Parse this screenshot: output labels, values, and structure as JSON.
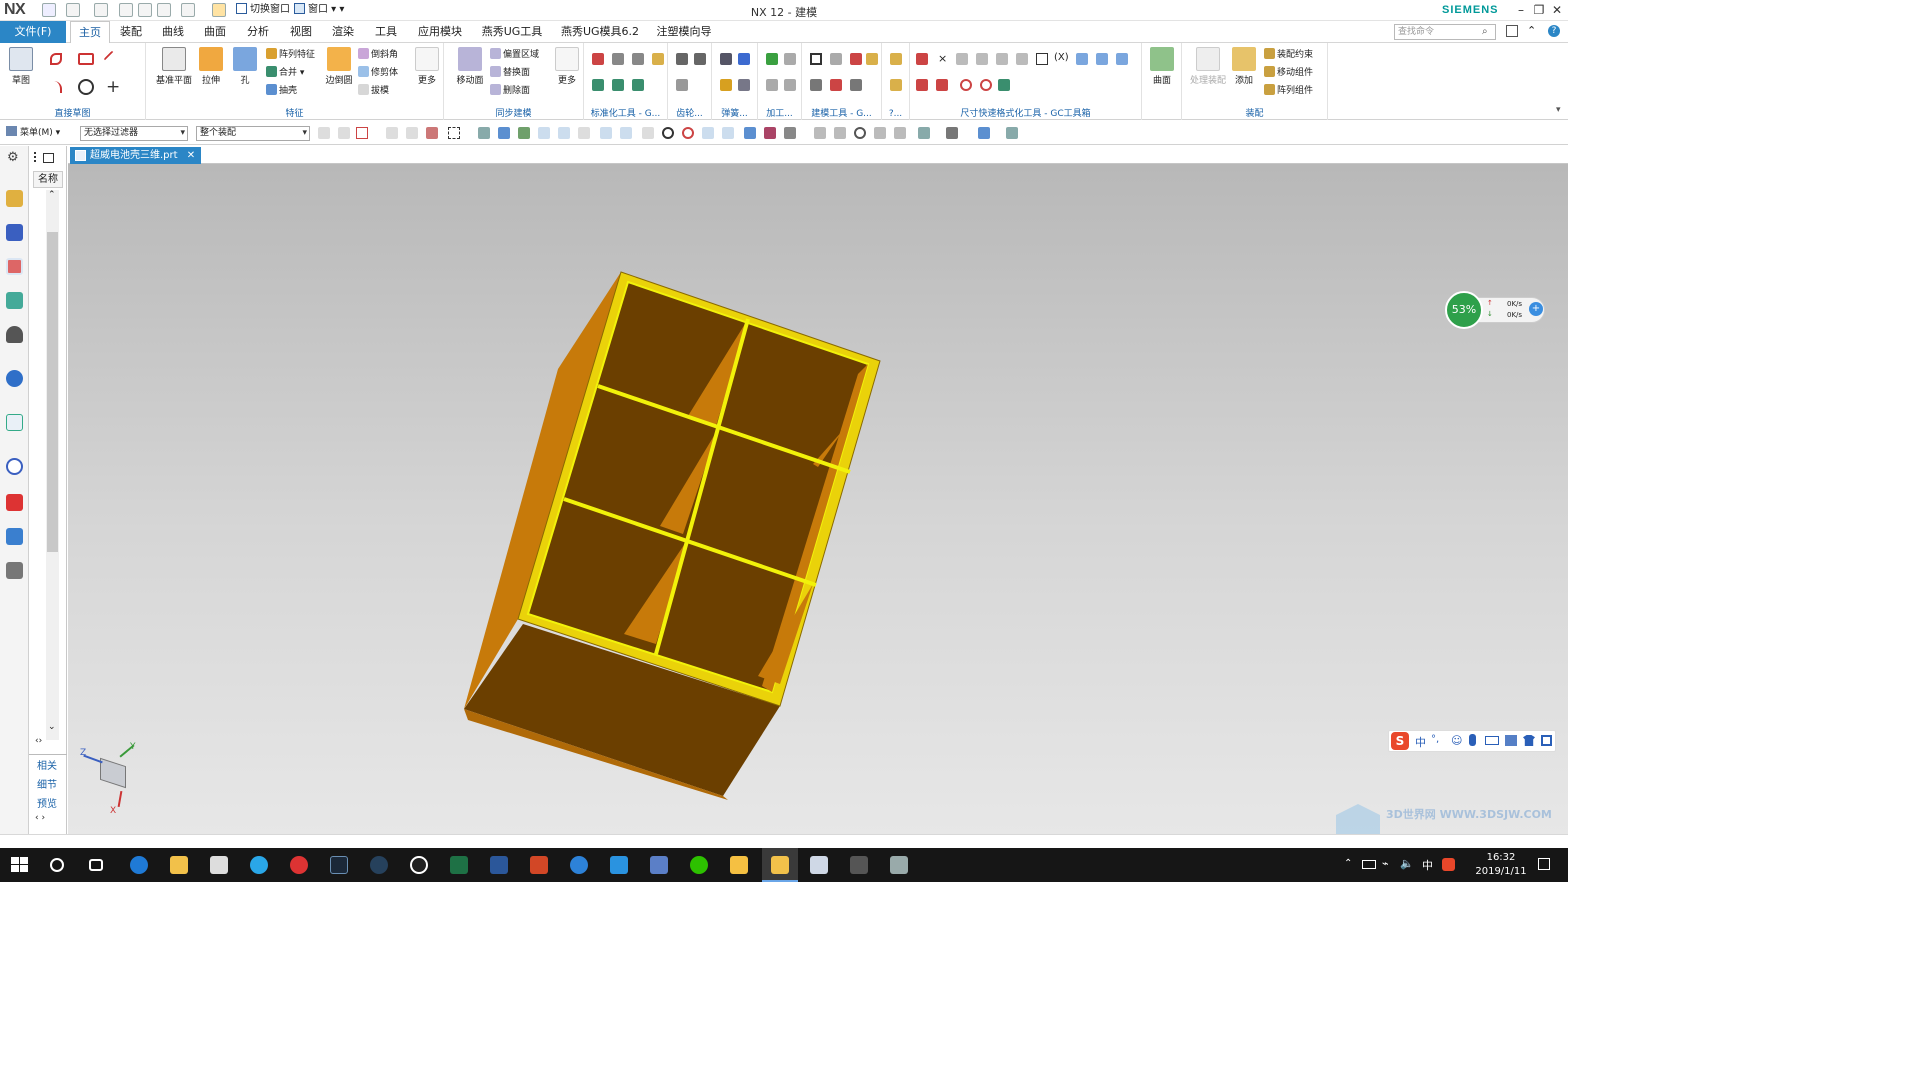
{
  "window": {
    "app_logo": "NX",
    "title": "NX 12 - 建模",
    "brand": "SIEMENS",
    "controls": [
      "minimize-icon",
      "restore-icon",
      "close-icon"
    ]
  },
  "quick_access": {
    "switch_window": "切换窗口",
    "window": "窗口"
  },
  "menubar": {
    "file": "文件(F)",
    "tabs": [
      "主页",
      "装配",
      "曲线",
      "曲面",
      "分析",
      "视图",
      "渲染",
      "工具",
      "应用模块",
      "燕秀UG工具",
      "燕秀UG模具6.2",
      "注塑模向导"
    ],
    "active_tab": "主页",
    "search_placeholder": "查找命令"
  },
  "ribbon": {
    "groups": [
      {
        "label": "直接草图",
        "buttons": [
          "草图"
        ]
      },
      {
        "label": "特征",
        "buttons": [
          "基准平面",
          "拉伸",
          "孔",
          "阵列特征",
          "合并",
          "抽壳",
          "边倒圆",
          "倒斜角",
          "修剪体",
          "拔模",
          "更多"
        ]
      },
      {
        "label": "同步建模",
        "buttons": [
          "移动面",
          "偏置区域",
          "替换面",
          "删除面",
          "更多"
        ]
      },
      {
        "label": "标准化工具 - G...",
        "buttons": []
      },
      {
        "label": "齿轮...",
        "buttons": []
      },
      {
        "label": "弹簧...",
        "buttons": []
      },
      {
        "label": "加工...",
        "buttons": []
      },
      {
        "label": "建模工具 - G...",
        "buttons": []
      },
      {
        "label": "?...",
        "buttons": []
      },
      {
        "label": "尺寸快速格式化工具 - GC工具箱",
        "buttons": []
      },
      {
        "label": "",
        "buttons": [
          "曲面"
        ]
      },
      {
        "label": "装配",
        "buttons": [
          "处理装配",
          "添加",
          "装配约束",
          "移动组件",
          "阵列组件"
        ]
      }
    ]
  },
  "toolbar2": {
    "menu": "菜单(M)",
    "filter": "无选择过滤器",
    "scope": "整个装配"
  },
  "navigator": {
    "header": "名称",
    "bottom_links": [
      "相关",
      "细节",
      "预览"
    ]
  },
  "document": {
    "tab": "超威电池壳三维.prt"
  },
  "triad": {
    "z": "Z",
    "y": "Y",
    "x": "X"
  },
  "net_widget": {
    "percent": "53%",
    "up": "0K/s",
    "down": "0K/s"
  },
  "ime_bar": {
    "mode": "中"
  },
  "watermark": "3D世界网 WWW.3DSJW.COM",
  "tray": {
    "time": "16:32",
    "date": "2019/1/11",
    "ime": "中"
  },
  "colors": {
    "accent": "#2b86c6",
    "model_body": "#c77a0a",
    "model_edge": "#f2f20a",
    "viewport_top": "#b8b8b8"
  }
}
